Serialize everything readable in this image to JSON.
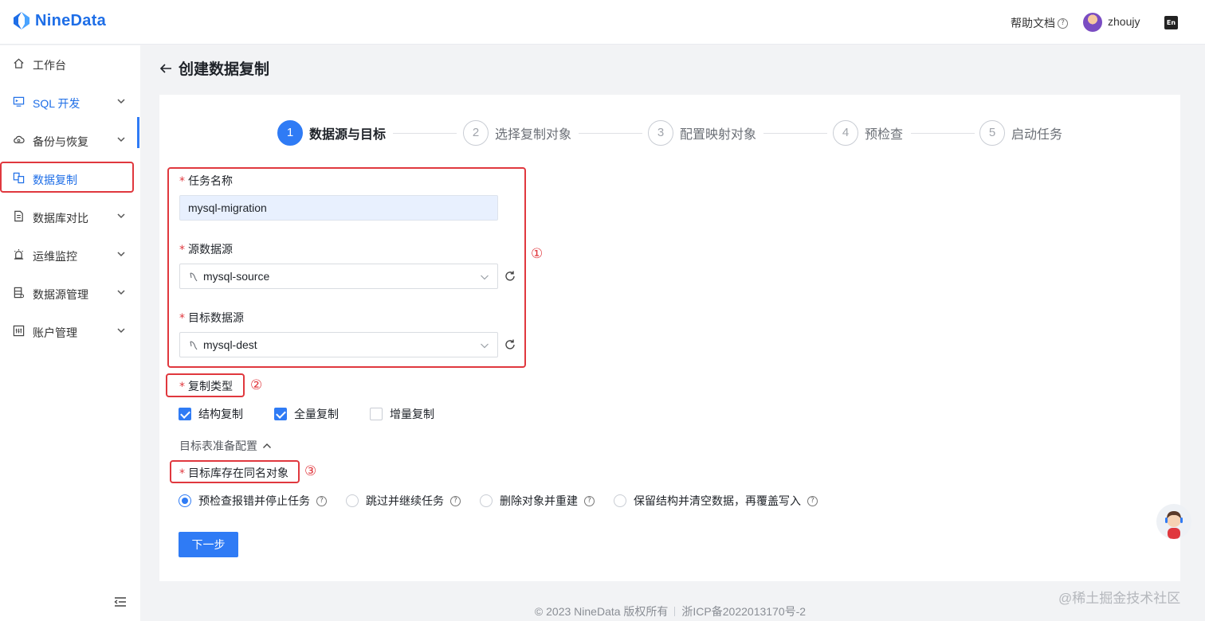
{
  "app": {
    "brand": "NineData",
    "brand_color": "#1e6ee7",
    "accent_color": "#2f7bf5",
    "annotation_color": "#e0383e"
  },
  "topbar": {
    "help_label": "帮助文档",
    "username": "zhoujy",
    "lang_icon_text": "En"
  },
  "sidebar": {
    "items": [
      {
        "label": "工作台",
        "icon": "home-icon",
        "expandable": false
      },
      {
        "label": "SQL 开发",
        "icon": "monitor-code-icon",
        "expandable": true
      },
      {
        "label": "备份与恢复",
        "icon": "cloud-backup-icon",
        "expandable": true
      },
      {
        "label": "数据复制",
        "icon": "data-replication-icon",
        "expandable": false,
        "active": true
      },
      {
        "label": "数据库对比",
        "icon": "compare-doc-icon",
        "expandable": true
      },
      {
        "label": "运维监控",
        "icon": "alarm-icon",
        "expandable": true
      },
      {
        "label": "数据源管理",
        "icon": "datasource-icon",
        "expandable": true
      },
      {
        "label": "账户管理",
        "icon": "account-icon",
        "expandable": true
      }
    ]
  },
  "page": {
    "title": "创建数据复制"
  },
  "steps": [
    {
      "num": "1",
      "label": "数据源与目标",
      "active": true
    },
    {
      "num": "2",
      "label": "选择复制对象",
      "active": false
    },
    {
      "num": "3",
      "label": "配置映射对象",
      "active": false
    },
    {
      "num": "4",
      "label": "预检查",
      "active": false
    },
    {
      "num": "5",
      "label": "启动任务",
      "active": false
    }
  ],
  "form": {
    "required_mark": "*",
    "task_name": {
      "label": "任务名称",
      "value": "mysql-migration"
    },
    "source": {
      "label": "源数据源",
      "value": "mysql-source"
    },
    "target": {
      "label": "目标数据源",
      "value": "mysql-dest"
    },
    "copy_type": {
      "label": "复制类型",
      "options": [
        {
          "label": "结构复制",
          "checked": true
        },
        {
          "label": "全量复制",
          "checked": true
        },
        {
          "label": "增量复制",
          "checked": false
        }
      ]
    },
    "target_prep_label": "目标表准备配置",
    "same_name": {
      "label": "目标库存在同名对象",
      "options": [
        {
          "label": "预检查报错并停止任务",
          "checked": true
        },
        {
          "label": "跳过并继续任务",
          "checked": false
        },
        {
          "label": "删除对象并重建",
          "checked": false
        },
        {
          "label": "保留结构并清空数据，再覆盖写入",
          "checked": false
        }
      ]
    },
    "next_label": "下一步"
  },
  "annotations": {
    "mark1": "①",
    "mark2": "②",
    "mark3": "③"
  },
  "footer": {
    "copyright": "© 2023 NineData 版权所有",
    "icp": "浙ICP备2022013170号-2"
  },
  "watermark": "@稀土掘金技术社区"
}
